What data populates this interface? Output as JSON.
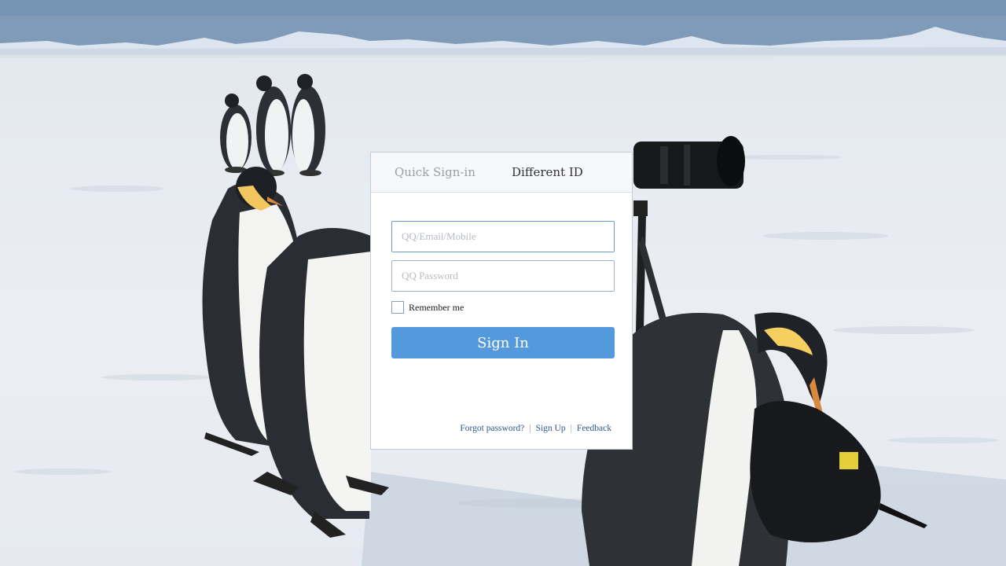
{
  "tabs": {
    "quick": "Quick Sign-in",
    "different": "Different ID"
  },
  "form": {
    "username_placeholder": "QQ/Email/Mobile",
    "username_value": "",
    "password_placeholder": "QQ Password",
    "password_value": "",
    "remember_label": "Remember me",
    "remember_checked": false,
    "signin_label": "Sign In"
  },
  "footer": {
    "forgot": "Forgot password?",
    "signup": "Sign Up",
    "feedback": "Feedback",
    "separator": "|"
  },
  "colors": {
    "signin_button": "#5599dd",
    "link": "#2d5a8a",
    "tab_bar": "#f6f8fc"
  },
  "background": {
    "icons": [
      "emperor-penguin",
      "camera-tripod",
      "snow-field"
    ]
  }
}
